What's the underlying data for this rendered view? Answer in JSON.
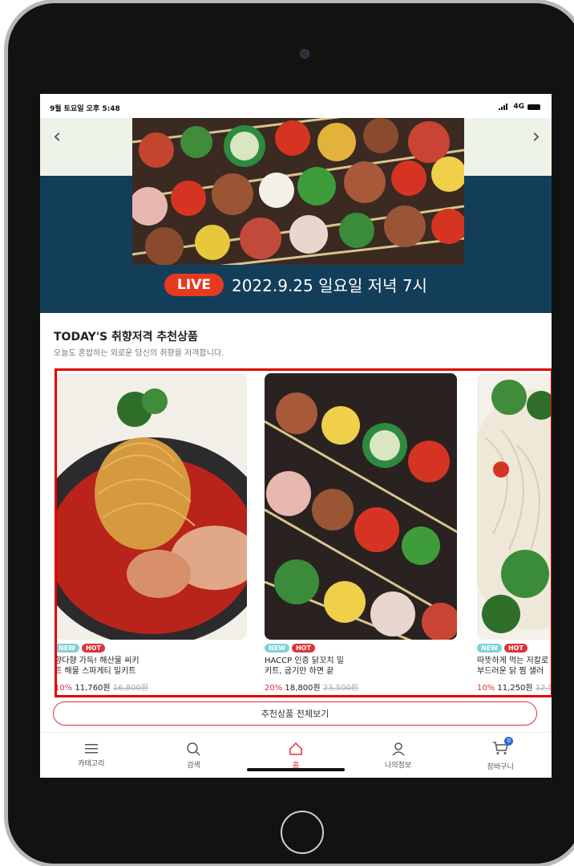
{
  "status_bar": {
    "time": "9월 토요일 오후 5:48",
    "network": "4G"
  },
  "banner": {
    "live_label": "LIVE",
    "live_text": "2022.9.25 일요일 저녁 7시"
  },
  "section": {
    "title": "TODAY'S 취향저격 추천상품",
    "subtitle": "오늘도 혼밥하는 외로운 당신의 취향을 저격합니다."
  },
  "products": [
    {
      "badges": [
        "NEW",
        "HOT"
      ],
      "name": "향다향 가득! 해산물 씨키\n트 해물 스파게티 밀키트",
      "discount": "10%",
      "price": "11,760원",
      "original_price": "16,800원"
    },
    {
      "badges": [
        "NEW",
        "HOT"
      ],
      "name": "HACCP 인증 닭꼬치 밀\n키트, 굽기만 하면 끝",
      "discount": "20%",
      "price": "18,800원",
      "original_price": "23,500원"
    },
    {
      "badges": [
        "NEW",
        "HOT"
      ],
      "name": "따뜻하게 먹는 저칼로\n부드러운 닭 찜 샐러",
      "discount": "10%",
      "price": "11,250원",
      "original_price": "12,5"
    }
  ],
  "view_all_button": "추천상품 전체보기",
  "tabbar": [
    {
      "label": "카테고리",
      "icon": "menu-icon"
    },
    {
      "label": "검색",
      "icon": "search-icon"
    },
    {
      "label": "홈",
      "icon": "home-icon"
    },
    {
      "label": "나의정보",
      "icon": "user-icon"
    },
    {
      "label": "장바구니",
      "icon": "cart-icon",
      "badge": "0"
    }
  ],
  "colors": {
    "accent": "#e0323a",
    "banner_bg": "#123e5a",
    "live": "#e63a1f",
    "highlight_border": "#e00000"
  }
}
